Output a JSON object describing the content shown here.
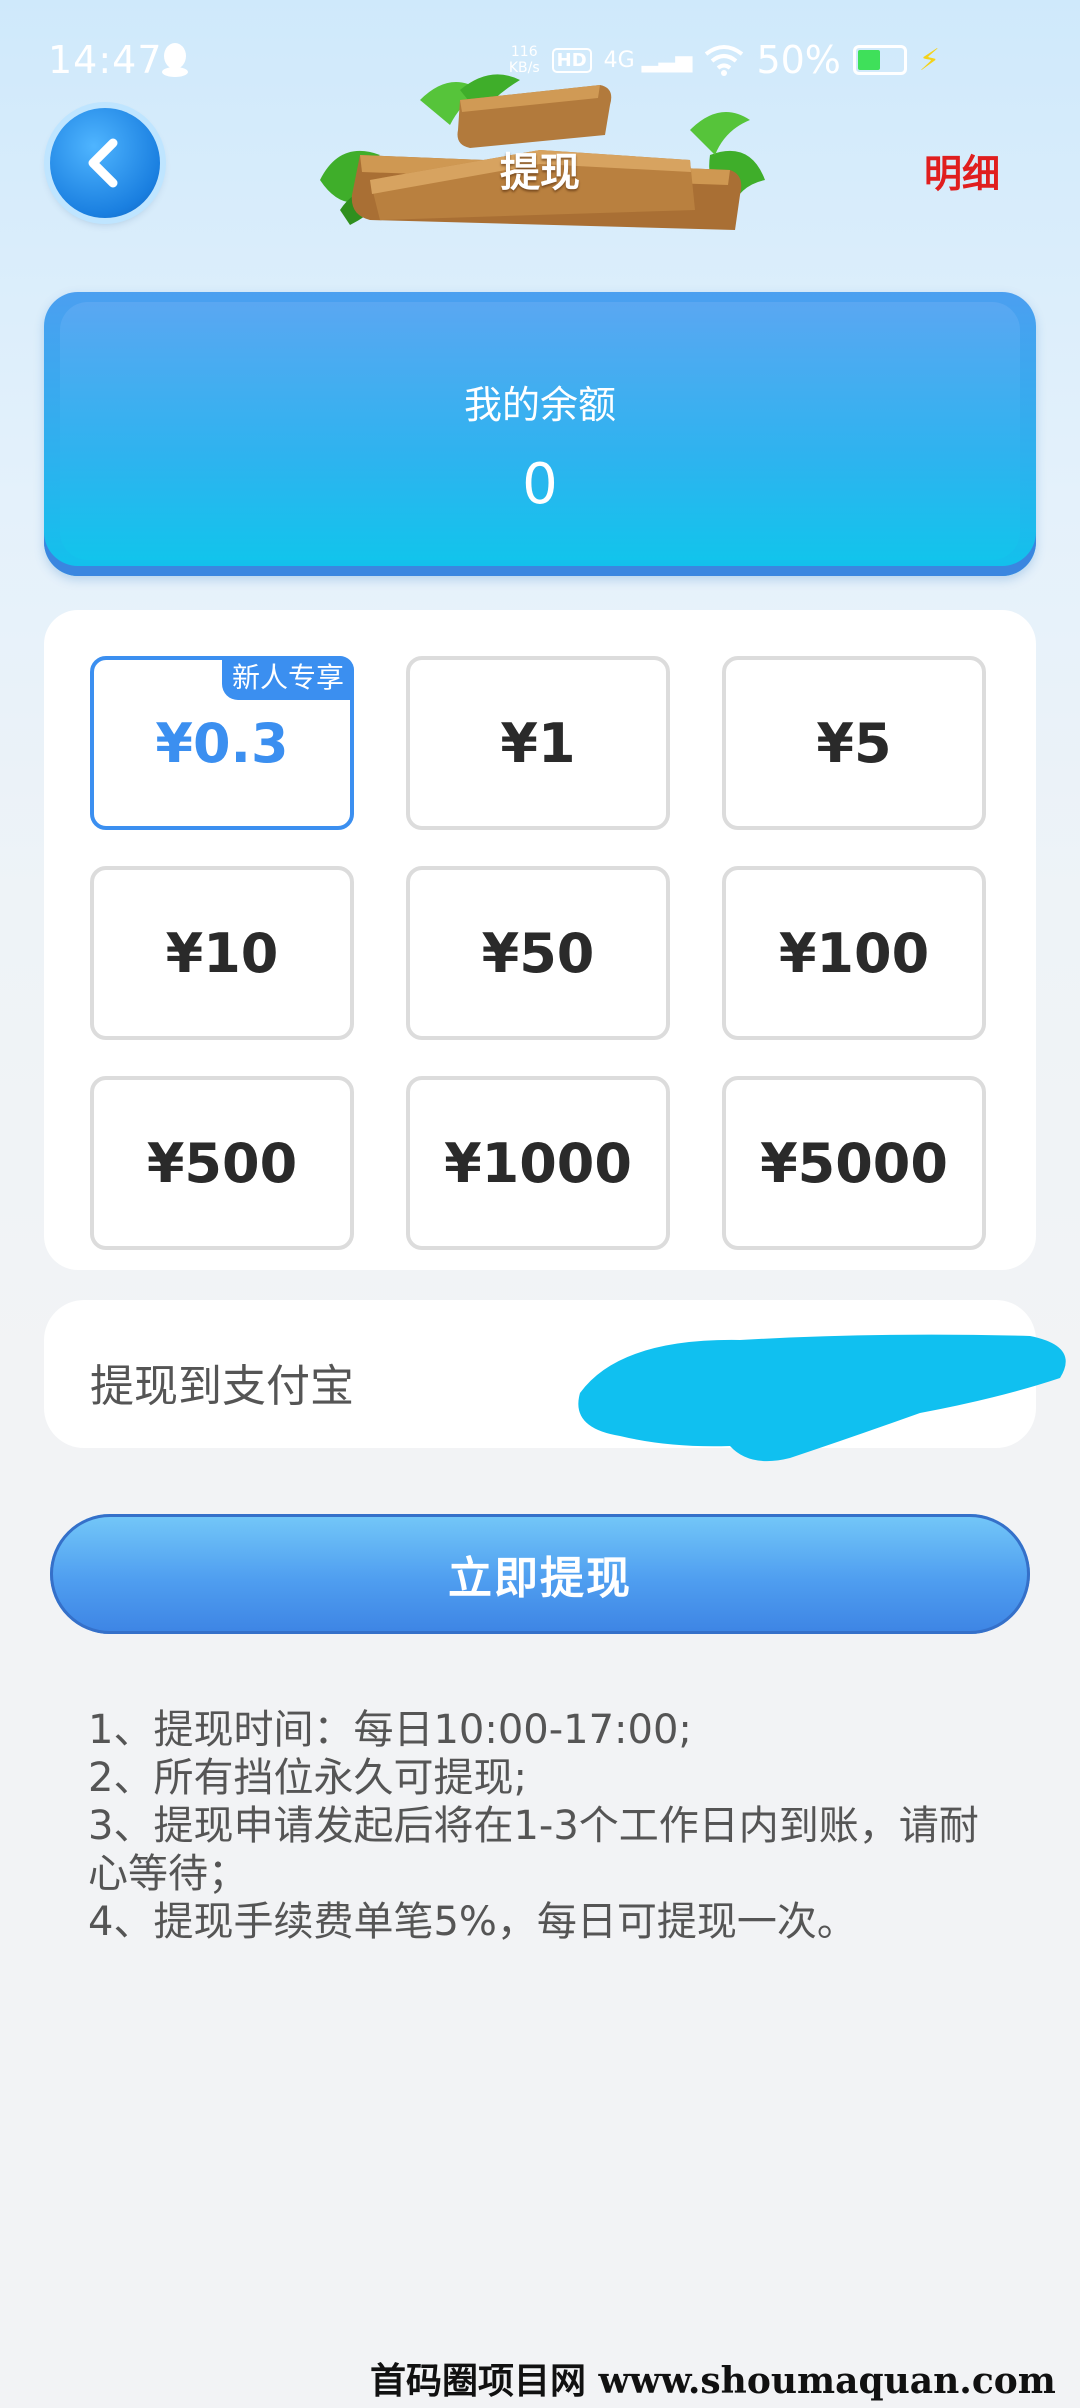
{
  "status_bar": {
    "time": "14:47",
    "net_speed_value": "116",
    "net_speed_unit": "KB/s",
    "hd": "HD",
    "network": "4G",
    "battery": "50%",
    "battery_level": 0.5,
    "icons": [
      "qq-icon",
      "wifi-icon",
      "signal-icon",
      "battery-icon",
      "charging-icon"
    ]
  },
  "header": {
    "back_icon": "chevron-left-icon",
    "title": "提现",
    "detail_link": "明细",
    "colors": {
      "detail": "#e01e1e"
    }
  },
  "balance": {
    "label": "我的余额",
    "value": "0"
  },
  "amounts": {
    "options": [
      {
        "label": "¥0.3",
        "selected": true,
        "badge": "新人专享"
      },
      {
        "label": "¥1"
      },
      {
        "label": "¥5"
      },
      {
        "label": "¥10"
      },
      {
        "label": "¥50"
      },
      {
        "label": "¥100"
      },
      {
        "label": "¥500"
      },
      {
        "label": "¥1000"
      },
      {
        "label": "¥5000"
      }
    ],
    "accent": "#3b8ff0"
  },
  "alipay": {
    "label": "提现到支付宝"
  },
  "action": {
    "withdraw_label": "立即提现"
  },
  "rules": [
    "1、提现时间：每日10:00-17:00;",
    "2、所有挡位永久可提现;",
    "3、提现申请发起后将在1-3个工作日内到账，请耐心等待；",
    "4、提现手续费单笔5%，每日可提现一次。"
  ],
  "watermark": "首码圈项目网 www.shoumaquan.com"
}
